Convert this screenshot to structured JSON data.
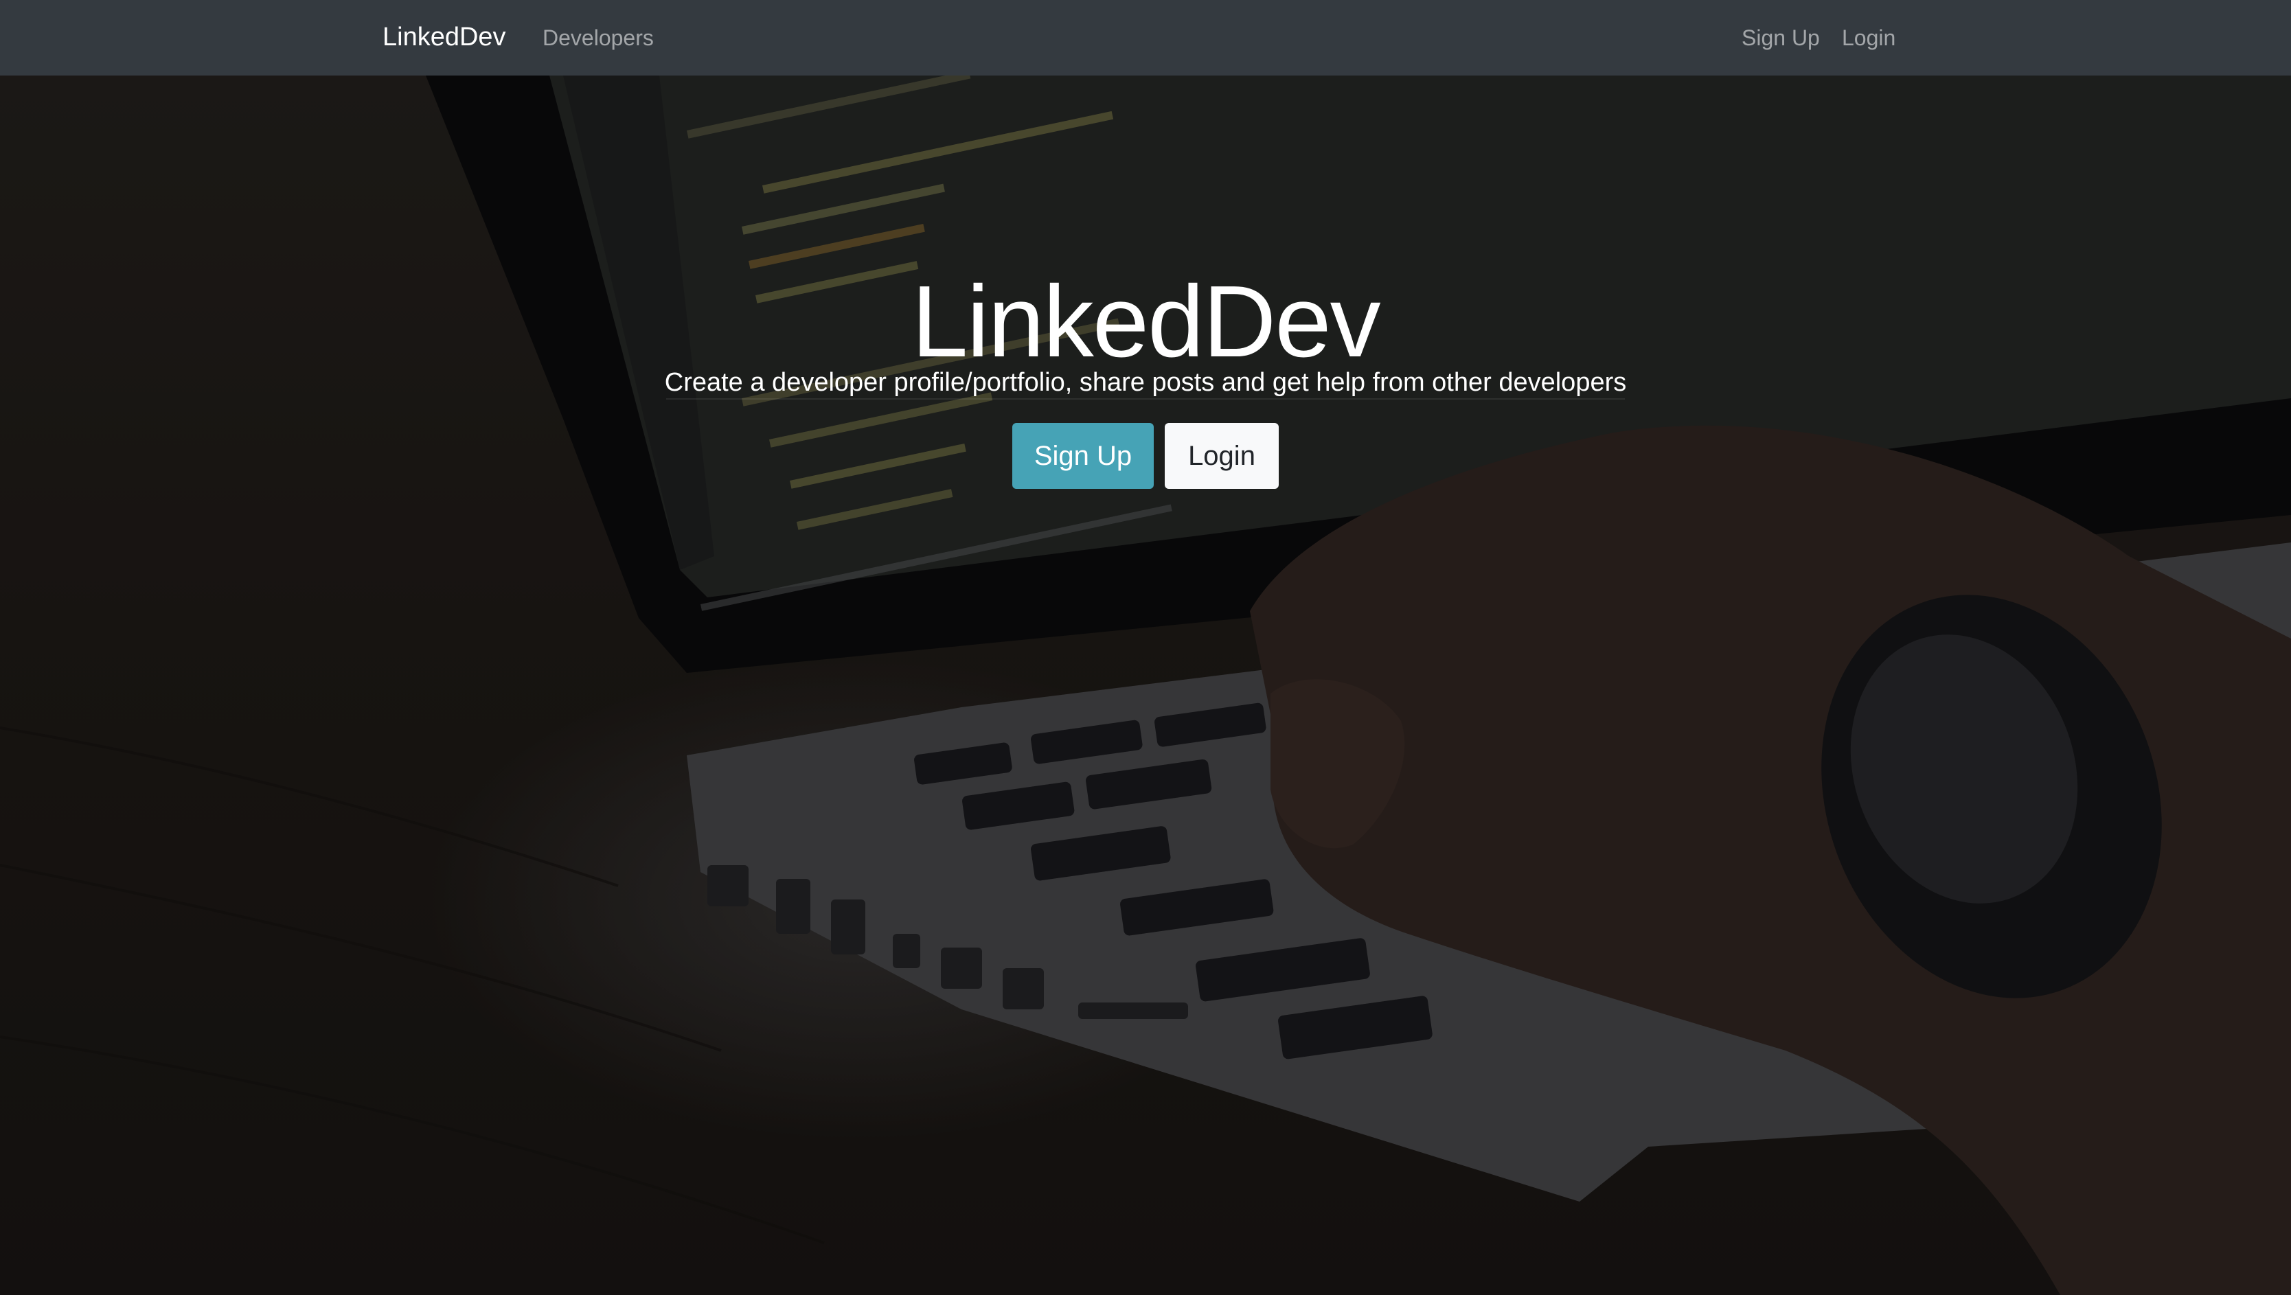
{
  "navbar": {
    "brand": "LinkedDev",
    "links_left": [
      {
        "label": "Developers"
      }
    ],
    "links_right": [
      {
        "label": "Sign Up"
      },
      {
        "label": "Login"
      }
    ]
  },
  "hero": {
    "title": "LinkedDev",
    "lead": "Create a developer profile/portfolio, share posts and get help from other developers",
    "buttons": {
      "signup": "Sign Up",
      "login": "Login"
    }
  },
  "colors": {
    "navbar_bg": "#343a40",
    "signup_button": "#46a3b6",
    "login_button": "#f8f9fa"
  },
  "icons": []
}
